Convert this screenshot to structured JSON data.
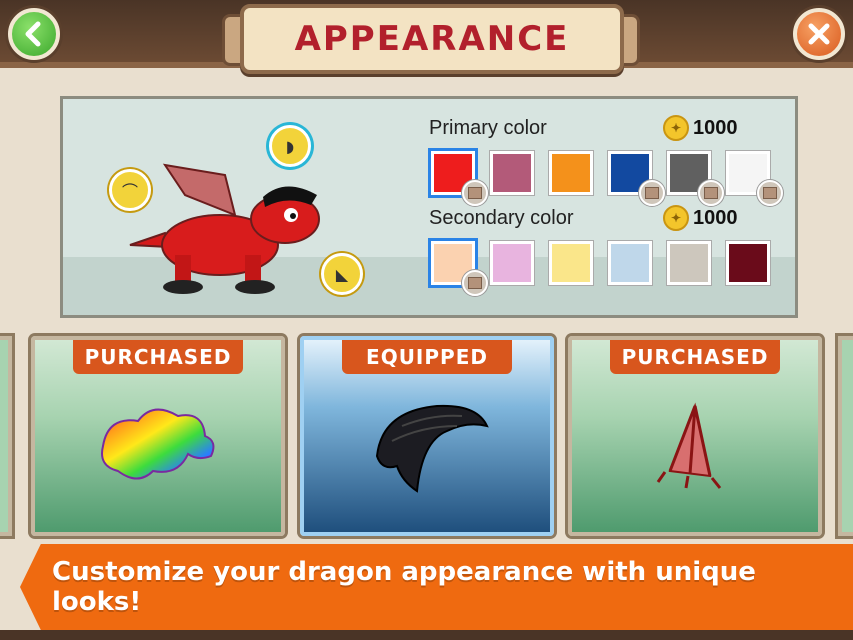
{
  "header": {
    "title": "APPEARANCE",
    "back_icon": "chevron-left-icon",
    "close_icon": "close-icon"
  },
  "preview": {
    "pins": [
      {
        "name": "head-accessory-pin",
        "icon": "hat-icon"
      },
      {
        "name": "hair-pin",
        "icon": "hair-icon",
        "active": true
      },
      {
        "name": "feet-pin",
        "icon": "claw-icon"
      }
    ]
  },
  "primary": {
    "label": "Primary color",
    "price": "1000",
    "swatches": [
      "#ee1d1d",
      "#b35a79",
      "#f4911b",
      "#1249a0",
      "#606060",
      "#f5f5f5"
    ],
    "selected": 0
  },
  "secondary": {
    "label": "Secondary color",
    "price": "1000",
    "swatches": [
      "#fbd2b0",
      "#e8b4df",
      "#fae68a",
      "#bfd7ea",
      "#cdc7bd",
      "#6a0b1a"
    ],
    "selected": 0
  },
  "cards": [
    {
      "status": "PURCHASED",
      "item": "rainbow-hair"
    },
    {
      "status": "EQUIPPED",
      "item": "black-pompadour-hair"
    },
    {
      "status": "PURCHASED",
      "item": "red-claw-feet"
    }
  ],
  "banner": {
    "text": "Customize your dragon appearance with unique looks!"
  }
}
